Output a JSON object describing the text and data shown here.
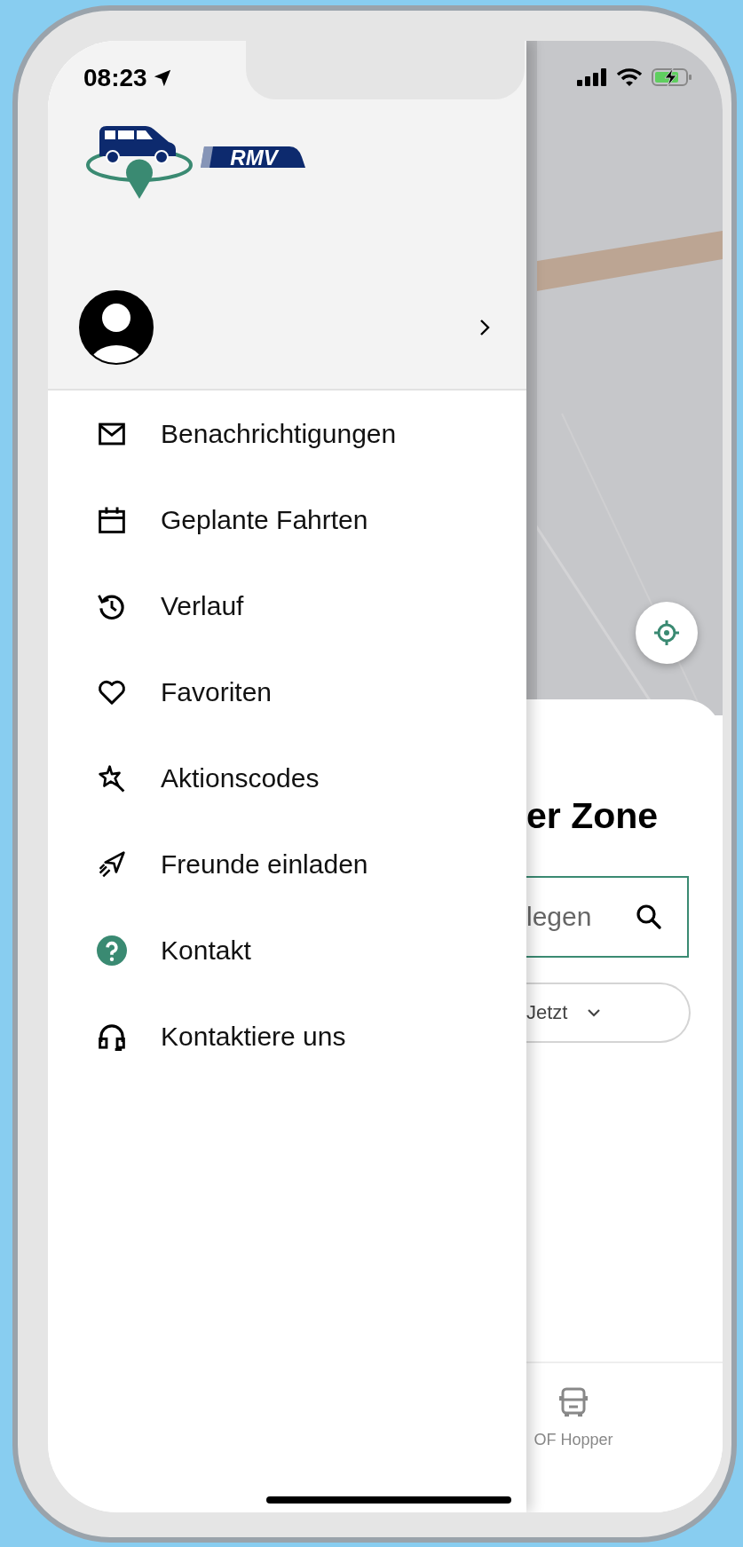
{
  "status_bar": {
    "time": "08:23"
  },
  "drawer": {
    "logo_text": "RMV",
    "menu": [
      {
        "label": "Benachrichtigungen"
      },
      {
        "label": "Geplante Fahrten"
      },
      {
        "label": "Verlauf"
      },
      {
        "label": "Favoriten"
      },
      {
        "label": "Aktionscodes"
      },
      {
        "label": "Freunde einladen"
      },
      {
        "label": "Kontakt"
      },
      {
        "label": "Kontaktiere uns"
      }
    ]
  },
  "sheet": {
    "title": "er Zone",
    "search": {
      "placeholder": "legen"
    },
    "time_select": {
      "value": "Jetzt"
    }
  },
  "tab_bar": {
    "tabs": [
      {
        "label": "OF Hopper"
      }
    ]
  }
}
